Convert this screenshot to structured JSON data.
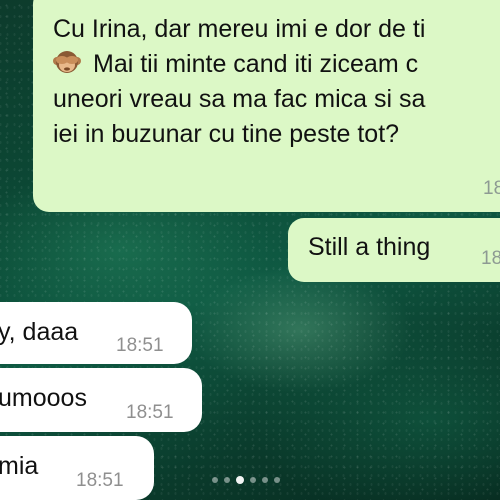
{
  "messages": [
    {
      "direction": "outgoing",
      "lines": [
        "Cu Irina, dar mereu imi e dor de ti",
        "Mai tii minte cand iti ziceam c",
        "uneori vreau sa ma fac mica si sa",
        "iei in buzunar cu tine peste tot?"
      ],
      "emoji": "see-no-evil-monkey",
      "time": "18"
    },
    {
      "direction": "outgoing",
      "text": "Still a thing",
      "time": "18"
    },
    {
      "direction": "incoming",
      "text": "y, daaa",
      "time": "18:51"
    },
    {
      "direction": "incoming",
      "text": "umooos",
      "time": "18:51"
    },
    {
      "direction": "incoming",
      "text": "mia",
      "time": "18:51"
    }
  ],
  "pager": {
    "total": 6,
    "active_index": 2
  },
  "colors": {
    "outgoing_bubble": "#dcf8c6",
    "incoming_bubble": "#ffffff",
    "background": "#0b4a36"
  }
}
